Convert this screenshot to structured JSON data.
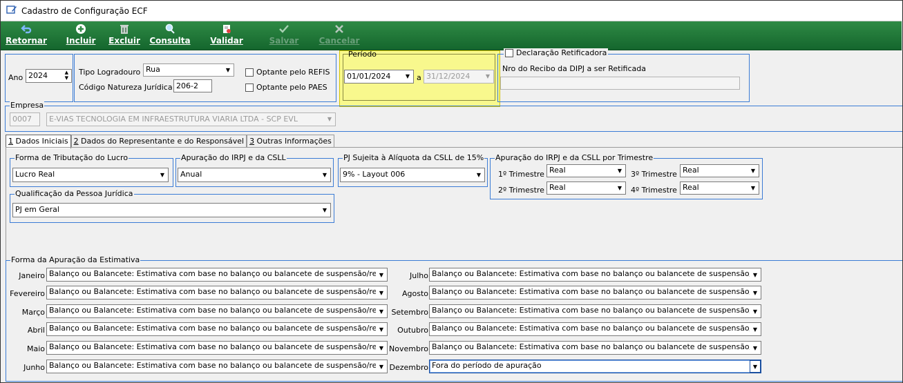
{
  "window": {
    "title": "Cadastro de Configuração ECF"
  },
  "toolbar": {
    "retornar": "Retornar",
    "incluir": "Incluir",
    "excluir": "Excluir",
    "consulta": "Consulta",
    "validar": "Validar",
    "salvar": "Salvar",
    "cancelar": "Cancelar"
  },
  "header": {
    "ano_label": "Ano",
    "ano_value": "2024",
    "tipo_logradouro_label": "Tipo Logradouro",
    "tipo_logradouro_value": "Rua",
    "codigo_natureza_label": "Código Natureza Jurídica",
    "codigo_natureza_value": "206-2",
    "refis_label": "Optante pelo REFIS",
    "paes_label": "Optante pelo PAES",
    "periodo_label": "Período",
    "periodo_inicio": "01/01/2024",
    "periodo_a": "a",
    "periodo_fim": "31/12/2024",
    "declaracao_label": "Declaração Retificadora",
    "nro_recibo_label": "Nro do Recibo da DIPJ a ser Retificada",
    "nro_recibo_value": ""
  },
  "empresa": {
    "label": "Empresa",
    "code": "0007",
    "name": "E-VIAS TECNOLOGIA EM INFRAESTRUTURA VIARIA LTDA - SCP EVL"
  },
  "tabs": [
    {
      "num": "1",
      "label": " Dados Iniciais"
    },
    {
      "num": "2",
      "label": " Dados do Representante e do Responsável"
    },
    {
      "num": "3",
      "label": " Outras Informações"
    }
  ],
  "dados_iniciais": {
    "forma_tributacao_label": "Forma de Tributação do Lucro",
    "forma_tributacao_value": "Lucro Real",
    "apuracao_irpj_label": "Apuração do IRPJ e da CSLL",
    "apuracao_irpj_value": "Anual",
    "aliquota_label": "PJ Sujeita à Alíquota da CSLL de 15%",
    "aliquota_value": "9% - Layout 006",
    "trimestre_label": "Apuração do IRPJ e da CSLL por Trimestre",
    "trimestres": [
      {
        "label": "1º Trimestre",
        "value": "Real"
      },
      {
        "label": "2º Trimestre",
        "value": "Real"
      },
      {
        "label": "3º Trimestre",
        "value": "Real"
      },
      {
        "label": "4º Trimestre",
        "value": "Real"
      }
    ],
    "qualificacao_label": "Qualificação da Pessoa Jurídica",
    "qualificacao_value": "PJ em Geral"
  },
  "estimativa": {
    "label": "Forma da Apuração da Estimativa",
    "meses_esq": [
      {
        "mes": "Janeiro",
        "value": "Balanço ou Balancete: Estimativa com base no balanço ou balancete de suspensão/redu"
      },
      {
        "mes": "Fevereiro",
        "value": "Balanço ou Balancete: Estimativa com base no balanço ou balancete de suspensão/redu"
      },
      {
        "mes": "Março",
        "value": "Balanço ou Balancete: Estimativa com base no balanço ou balancete de suspensão/redu"
      },
      {
        "mes": "Abril",
        "value": "Balanço ou Balancete: Estimativa com base no balanço ou balancete de suspensão/redu"
      },
      {
        "mes": "Maio",
        "value": "Balanço ou Balancete: Estimativa com base no balanço ou balancete de suspensão/redu"
      },
      {
        "mes": "Junho",
        "value": "Balanço ou Balancete: Estimativa com base no balanço ou balancete de suspensão/redu"
      }
    ],
    "meses_dir": [
      {
        "mes": "Julho",
        "value": "Balanço ou Balancete: Estimativa com base no balanço ou balancete de suspensão/r"
      },
      {
        "mes": "Agosto",
        "value": "Balanço ou Balancete: Estimativa com base no balanço ou balancete de suspensão/r"
      },
      {
        "mes": "Setembro",
        "value": "Balanço ou Balancete: Estimativa com base no balanço ou balancete de suspensão/r"
      },
      {
        "mes": "Outubro",
        "value": "Balanço ou Balancete: Estimativa com base no balanço ou balancete de suspensão/r"
      },
      {
        "mes": "Novembro",
        "value": "Balanço ou Balancete: Estimativa com base no balanço ou balancete de suspensão/r"
      },
      {
        "mes": "Dezembro",
        "value": "Fora do período de apuração"
      }
    ]
  }
}
